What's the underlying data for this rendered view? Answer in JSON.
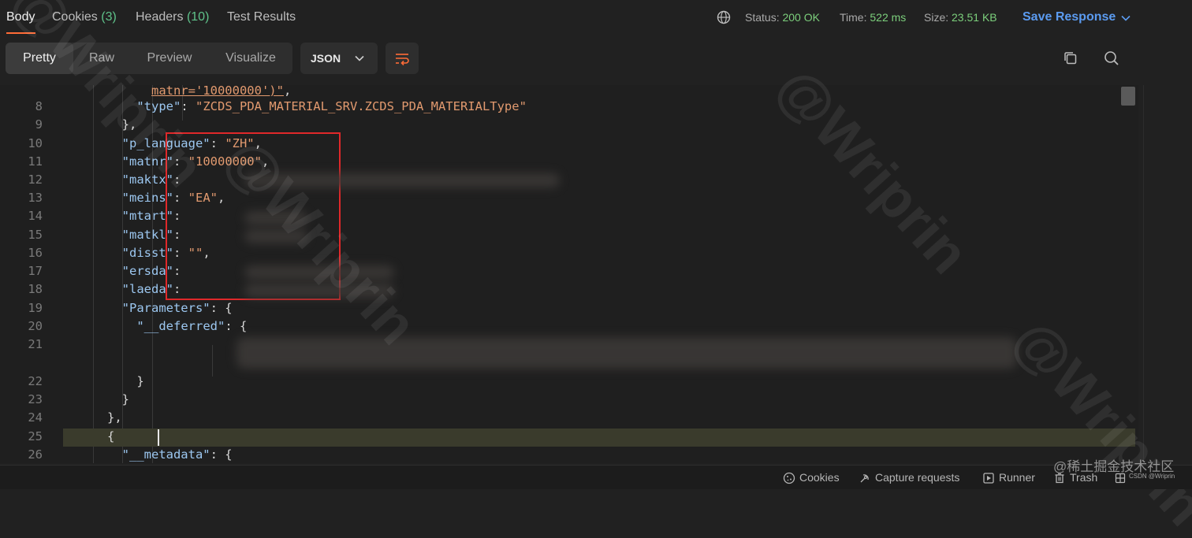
{
  "tabs": [
    {
      "label": "Body",
      "count": ""
    },
    {
      "label": "Cookies",
      "count": "(3)"
    },
    {
      "label": "Headers",
      "count": "(10)"
    },
    {
      "label": "Test Results",
      "count": ""
    }
  ],
  "status": {
    "status_label": "Status:",
    "status_value": "200 OK",
    "time_label": "Time:",
    "time_value": "522 ms",
    "size_label": "Size:",
    "size_value": "23.51 KB"
  },
  "save_response_label": "Save Response",
  "view_modes": [
    "Pretty",
    "Raw",
    "Preview",
    "Visualize"
  ],
  "format": "JSON",
  "code_lines": [
    {
      "n": "",
      "indent": "            ",
      "parts": [
        {
          "t": "s",
          "v": "matnr='10000000')\""
        },
        {
          "t": "p",
          "v": ","
        }
      ]
    },
    {
      "n": "8",
      "indent": "          ",
      "parts": [
        {
          "t": "k",
          "v": "\"type\""
        },
        {
          "t": "p",
          "v": ": "
        },
        {
          "t": "s",
          "v": "\"ZCDS_PDA_MATERIAL_SRV.ZCDS_PDA_MATERIALType\""
        }
      ]
    },
    {
      "n": "9",
      "indent": "        ",
      "parts": [
        {
          "t": "p",
          "v": "},"
        }
      ]
    },
    {
      "n": "10",
      "indent": "        ",
      "parts": [
        {
          "t": "k",
          "v": "\"p_language\""
        },
        {
          "t": "p",
          "v": ": "
        },
        {
          "t": "s",
          "v": "\"ZH\""
        },
        {
          "t": "p",
          "v": ","
        }
      ]
    },
    {
      "n": "11",
      "indent": "        ",
      "parts": [
        {
          "t": "k",
          "v": "\"matnr\""
        },
        {
          "t": "p",
          "v": ": "
        },
        {
          "t": "s",
          "v": "\"10000000\""
        },
        {
          "t": "p",
          "v": ","
        }
      ]
    },
    {
      "n": "12",
      "indent": "        ",
      "parts": [
        {
          "t": "k",
          "v": "\"maktx\""
        },
        {
          "t": "p",
          "v": ":"
        }
      ]
    },
    {
      "n": "13",
      "indent": "        ",
      "parts": [
        {
          "t": "k",
          "v": "\"meins\""
        },
        {
          "t": "p",
          "v": ": "
        },
        {
          "t": "s",
          "v": "\"EA\""
        },
        {
          "t": "p",
          "v": ","
        }
      ]
    },
    {
      "n": "14",
      "indent": "        ",
      "parts": [
        {
          "t": "k",
          "v": "\"mtart\""
        },
        {
          "t": "p",
          "v": ":"
        }
      ]
    },
    {
      "n": "15",
      "indent": "        ",
      "parts": [
        {
          "t": "k",
          "v": "\"matkl\""
        },
        {
          "t": "p",
          "v": ":"
        }
      ]
    },
    {
      "n": "16",
      "indent": "        ",
      "parts": [
        {
          "t": "k",
          "v": "\"disst\""
        },
        {
          "t": "p",
          "v": ": "
        },
        {
          "t": "s",
          "v": "\"\""
        },
        {
          "t": "p",
          "v": ","
        }
      ]
    },
    {
      "n": "17",
      "indent": "        ",
      "parts": [
        {
          "t": "k",
          "v": "\"ersda\""
        },
        {
          "t": "p",
          "v": ":"
        }
      ]
    },
    {
      "n": "18",
      "indent": "        ",
      "parts": [
        {
          "t": "k",
          "v": "\"laeda\""
        },
        {
          "t": "p",
          "v": ":"
        }
      ]
    },
    {
      "n": "19",
      "indent": "        ",
      "parts": [
        {
          "t": "k",
          "v": "\"Parameters\""
        },
        {
          "t": "p",
          "v": ": {"
        }
      ]
    },
    {
      "n": "20",
      "indent": "          ",
      "parts": [
        {
          "t": "k",
          "v": "\"__deferred\""
        },
        {
          "t": "p",
          "v": ": {"
        }
      ]
    },
    {
      "n": "21",
      "indent": "",
      "parts": []
    },
    {
      "n": "",
      "indent": "",
      "parts": []
    },
    {
      "n": "22",
      "indent": "          ",
      "parts": [
        {
          "t": "p",
          "v": "}"
        }
      ]
    },
    {
      "n": "23",
      "indent": "        ",
      "parts": [
        {
          "t": "p",
          "v": "}"
        }
      ]
    },
    {
      "n": "24",
      "indent": "      ",
      "parts": [
        {
          "t": "p",
          "v": "},"
        }
      ]
    },
    {
      "n": "25",
      "indent": "      ",
      "parts": [
        {
          "t": "p",
          "v": "{"
        }
      ]
    },
    {
      "n": "26",
      "indent": "        ",
      "parts": [
        {
          "t": "k",
          "v": "\"__metadata\""
        },
        {
          "t": "p",
          "v": ": {"
        }
      ]
    }
  ],
  "statusbar": {
    "cookies": "Cookies",
    "capture": "Capture requests",
    "runner": "Runner",
    "trash": "Trash"
  },
  "watermarks": [
    "@Wriprin",
    "@Wriprin",
    "@Wriprin",
    "@Wriprin"
  ],
  "csdn_watermark": "@稀土掘金技术社区",
  "csdn_small": "CSDN @Wriprin",
  "colors": {
    "background": "#212121",
    "accent_orange": "#ff6c37",
    "success_green": "#7ccf7c",
    "link_blue": "#5b9bf0",
    "json_key": "#9cc7f0",
    "json_string": "#e29a6f",
    "highlight_box": "#e0282a"
  }
}
